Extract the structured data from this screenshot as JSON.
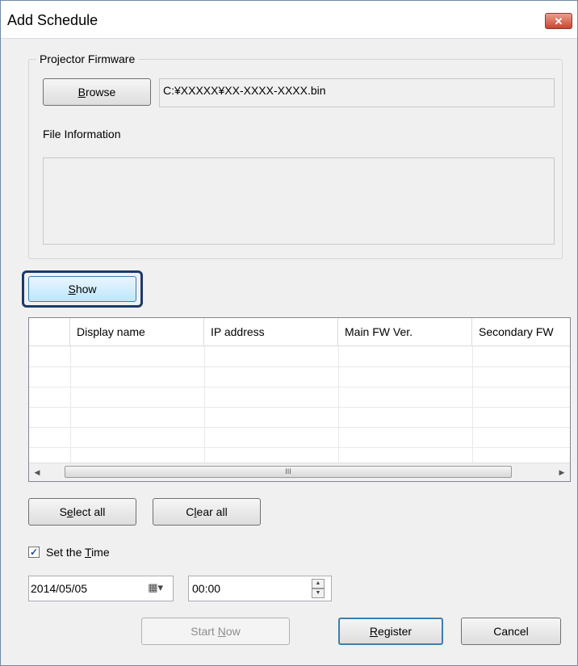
{
  "window": {
    "title": "Add Schedule",
    "close_glyph": "✕"
  },
  "firmware": {
    "group_label": "Projector Firmware",
    "browse_label_pre": "",
    "browse_label_ul": "B",
    "browse_label_post": "rowse",
    "path_value": "C:¥XXXXX¥XX-XXXX-XXXX.bin",
    "file_info_label": "File Information",
    "file_info_value": ""
  },
  "show_button": {
    "label_ul": "S",
    "label_post": "how"
  },
  "grid": {
    "columns": [
      "",
      "Display name",
      "IP address",
      "Main FW Ver.",
      "Secondary FW"
    ],
    "rows": [],
    "scroll_left": "◀",
    "scroll_right": "▶",
    "scroll_grip": "III"
  },
  "selection": {
    "select_all_pre": "S",
    "select_all_ul": "e",
    "select_all_post": "lect all",
    "clear_all_pre": "C",
    "clear_all_ul": "l",
    "clear_all_post": "ear all"
  },
  "time": {
    "checkbox_checked": true,
    "check_glyph": "✓",
    "label_pre": "Set the ",
    "label_ul": "T",
    "label_post": "ime",
    "date_value": "2014/05/05",
    "calendar_glyph": "▦▾",
    "time_value": "00:00",
    "spin_up": "▲",
    "spin_down": "▼"
  },
  "actions": {
    "start_now_pre": "Start ",
    "start_now_ul": "N",
    "start_now_post": "ow",
    "register_ul": "R",
    "register_post": "egister",
    "cancel_label": "Cancel"
  },
  "colors": {
    "highlight_border": "#1c3a6a",
    "accent": "#3c7fb1",
    "close_button": "#c9452f"
  }
}
